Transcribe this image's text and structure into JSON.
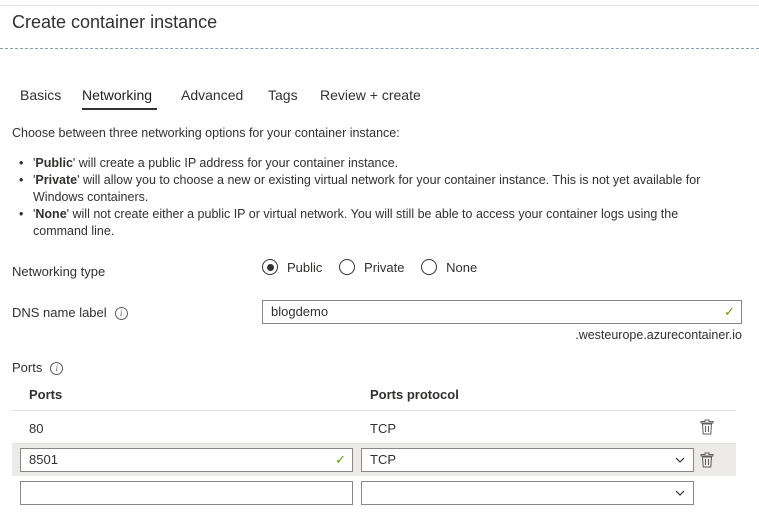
{
  "page": {
    "title": "Create container instance"
  },
  "tabs": [
    {
      "label": "Basics"
    },
    {
      "label": "Networking",
      "active": true
    },
    {
      "label": "Advanced"
    },
    {
      "label": "Tags"
    },
    {
      "label": "Review + create"
    }
  ],
  "intro": "Choose between three networking options for your container instance:",
  "bullets": [
    {
      "pre": "'",
      "bold": "Public",
      "post": "' will create a public IP address for your container instance."
    },
    {
      "pre": "'",
      "bold": "Private",
      "post": "' will allow you to choose a new or existing virtual network for your container instance. This is not yet available for Windows containers."
    },
    {
      "pre": "'",
      "bold": "None",
      "post": "' will not create either a public IP or virtual network. You will still be able to access your container logs using the command line."
    }
  ],
  "networking_type": {
    "label": "Networking type",
    "options": [
      "Public",
      "Private",
      "None"
    ],
    "selected": "Public"
  },
  "dns": {
    "label": "DNS name label",
    "value": "blogdemo",
    "suffix": ".westeurope.azurecontainer.io"
  },
  "ports": {
    "label": "Ports",
    "col_ports": "Ports",
    "col_protocol": "Ports protocol",
    "rows": [
      {
        "port": "80",
        "protocol": "TCP"
      }
    ],
    "edit_row": {
      "port": "8501",
      "protocol": "TCP"
    },
    "new_row": {
      "port": "",
      "protocol": ""
    }
  },
  "colors": {
    "accent": "#323130",
    "valid": "#57a300",
    "selected_row": "#edebe9"
  },
  "icons": {
    "info": "info-icon",
    "check": "checkmark-icon",
    "delete": "trash-icon",
    "dropdown": "chevron-down-icon"
  }
}
